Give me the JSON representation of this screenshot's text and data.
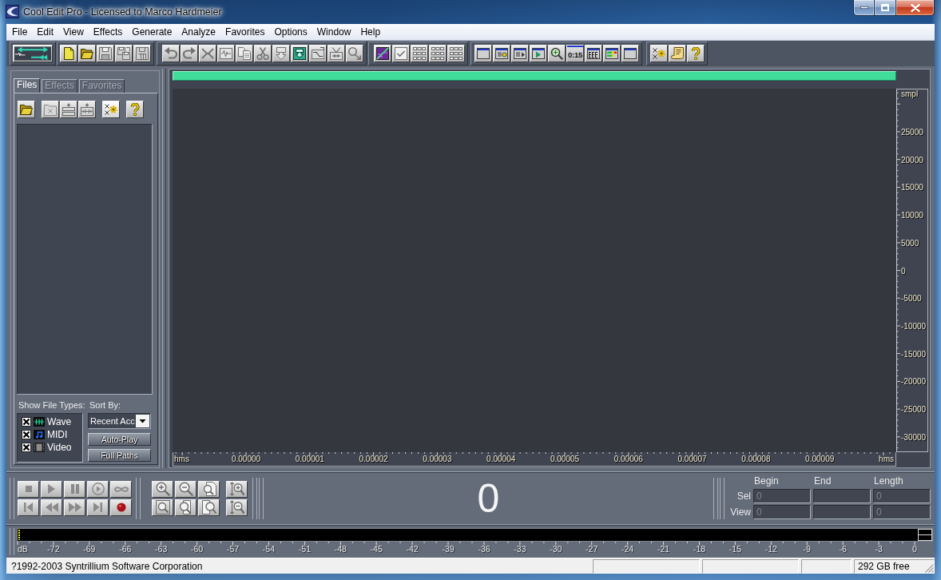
{
  "window": {
    "title": "Cool Edit Pro - Licensed to Marco Hardmeier"
  },
  "menu": [
    "File",
    "Edit",
    "View",
    "Effects",
    "Generate",
    "Analyze",
    "Favorites",
    "Options",
    "Window",
    "Help"
  ],
  "toolbar": {
    "time_format_button": {
      "label": "0:15"
    }
  },
  "organizer": {
    "tabs": [
      {
        "label": "Files",
        "selected": true
      },
      {
        "label": "Effects",
        "selected": false
      },
      {
        "label": "Favorites",
        "selected": false
      }
    ],
    "show_file_types": {
      "label": "Show File Types:",
      "types": [
        {
          "label": "Wave",
          "checked": true
        },
        {
          "label": "MIDI",
          "checked": true
        },
        {
          "label": "Video",
          "checked": true
        }
      ]
    },
    "sort_by": {
      "label": "Sort By:",
      "value": "Recent Acc"
    },
    "buttons": [
      "Auto-Play",
      "Full Paths"
    ]
  },
  "waveform": {
    "sample_axis": {
      "unit": "smpl",
      "ticks": [
        "25000",
        "20000",
        "15000",
        "10000",
        "5000",
        "0",
        "-5000",
        "-10000",
        "-15000",
        "-20000",
        "-25000",
        "-30000"
      ]
    },
    "time_axis": {
      "start_label": "hms",
      "ticks": [
        "0.00000",
        "0.00001",
        "0.00002",
        "0.00003",
        "0.00004",
        "0.00005",
        "0.00006",
        "0.00007",
        "0.00008",
        "0.00009"
      ],
      "end_label": "hms"
    }
  },
  "transport": {
    "time_display": "0"
  },
  "selection": {
    "columns": [
      "Begin",
      "End",
      "Length"
    ],
    "rows": [
      {
        "label": "Sel",
        "begin": "0",
        "length": "0"
      },
      {
        "label": "View",
        "begin": "0",
        "length": "0"
      }
    ]
  },
  "level_meter": {
    "scale": [
      "dB",
      "-72",
      "-69",
      "-66",
      "-63",
      "-60",
      "-57",
      "-54",
      "-51",
      "-48",
      "-45",
      "-42",
      "-39",
      "-36",
      "-33",
      "-30",
      "-27",
      "-24",
      "-21",
      "-18",
      "-15",
      "-12",
      "-9",
      "-6",
      "-3",
      "0"
    ]
  },
  "status_bar": {
    "message": "?1992-2003 Syntrillium Software Corporation",
    "disk_free": "292 GB free"
  }
}
